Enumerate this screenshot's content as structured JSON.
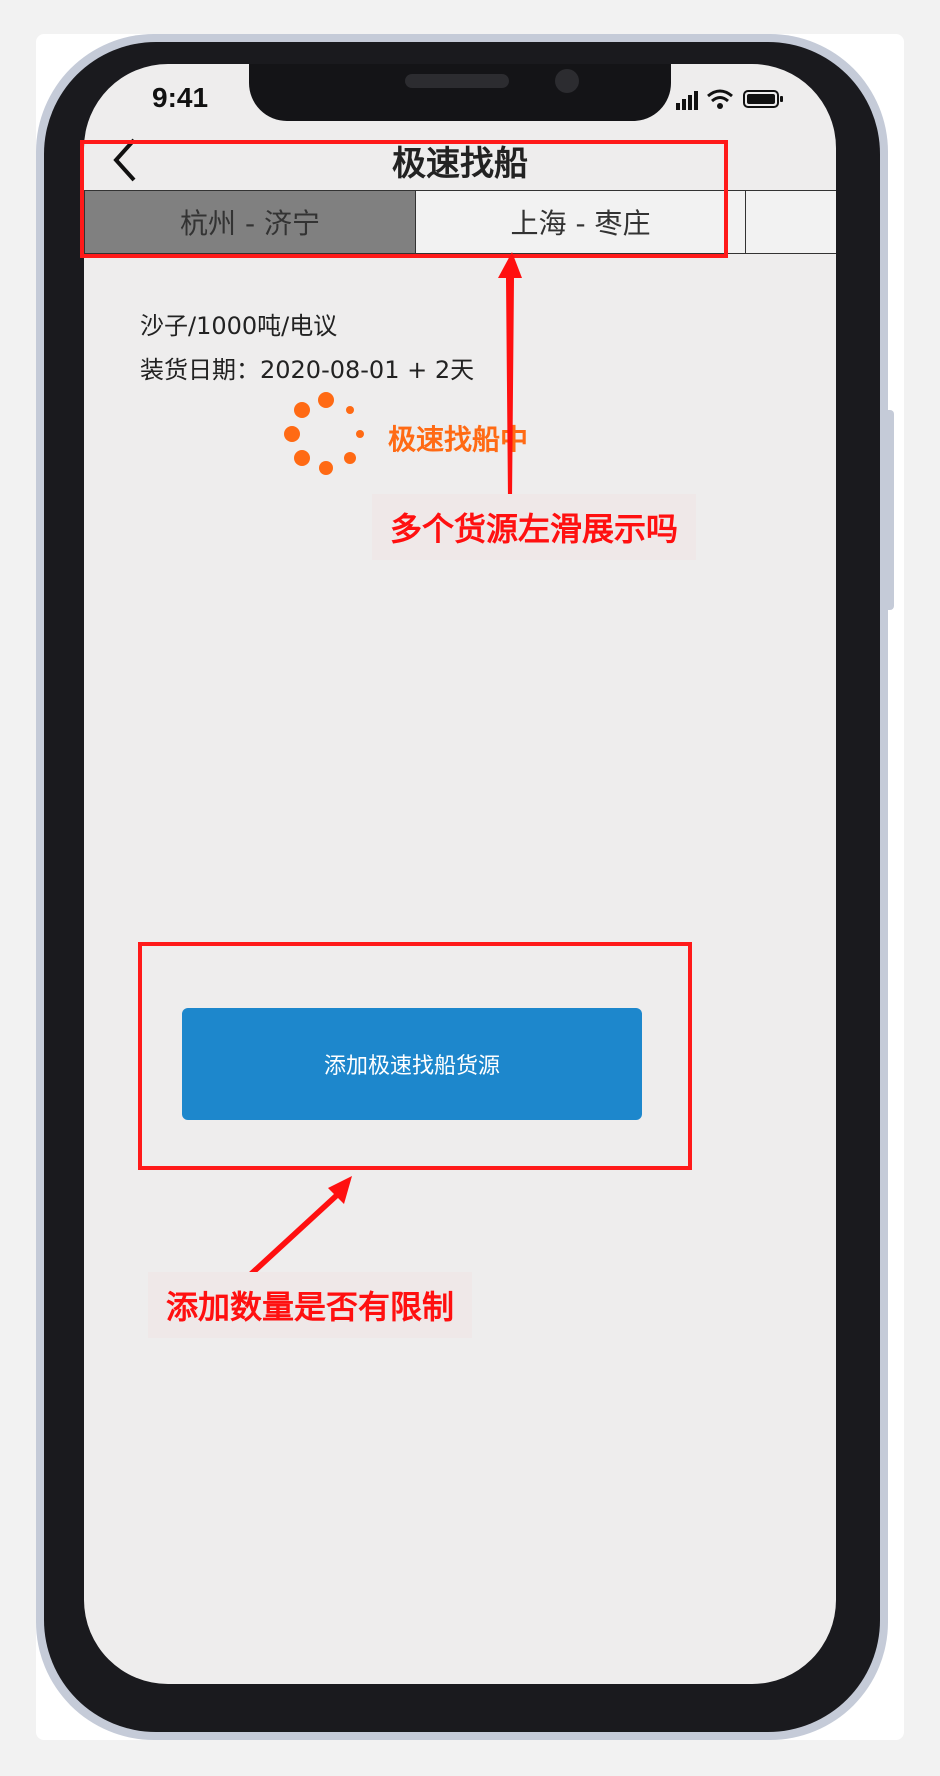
{
  "status_bar": {
    "time": "9:41",
    "icons": [
      "signal-icon",
      "wifi-icon",
      "battery-icon"
    ]
  },
  "nav": {
    "back_icon": "chevron-left-icon",
    "title": "极速找船"
  },
  "route_tabs": [
    {
      "label": "杭州 - 济宁",
      "active": true
    },
    {
      "label": "上海 - 枣庄",
      "active": false
    }
  ],
  "cargo": {
    "summary": "沙子/1000吨/电议",
    "loading_date": "装货日期：2020-08-01 + 2天"
  },
  "searching": {
    "label": "极速找船中",
    "color": "#ff6a14"
  },
  "add_button": {
    "label": "添加极速找船货源",
    "color": "#1d87cc"
  },
  "annotations": {
    "swipe_note": "多个货源左滑展示吗",
    "limit_note": "添加数量是否有限制",
    "color": "#ff1a1a"
  }
}
